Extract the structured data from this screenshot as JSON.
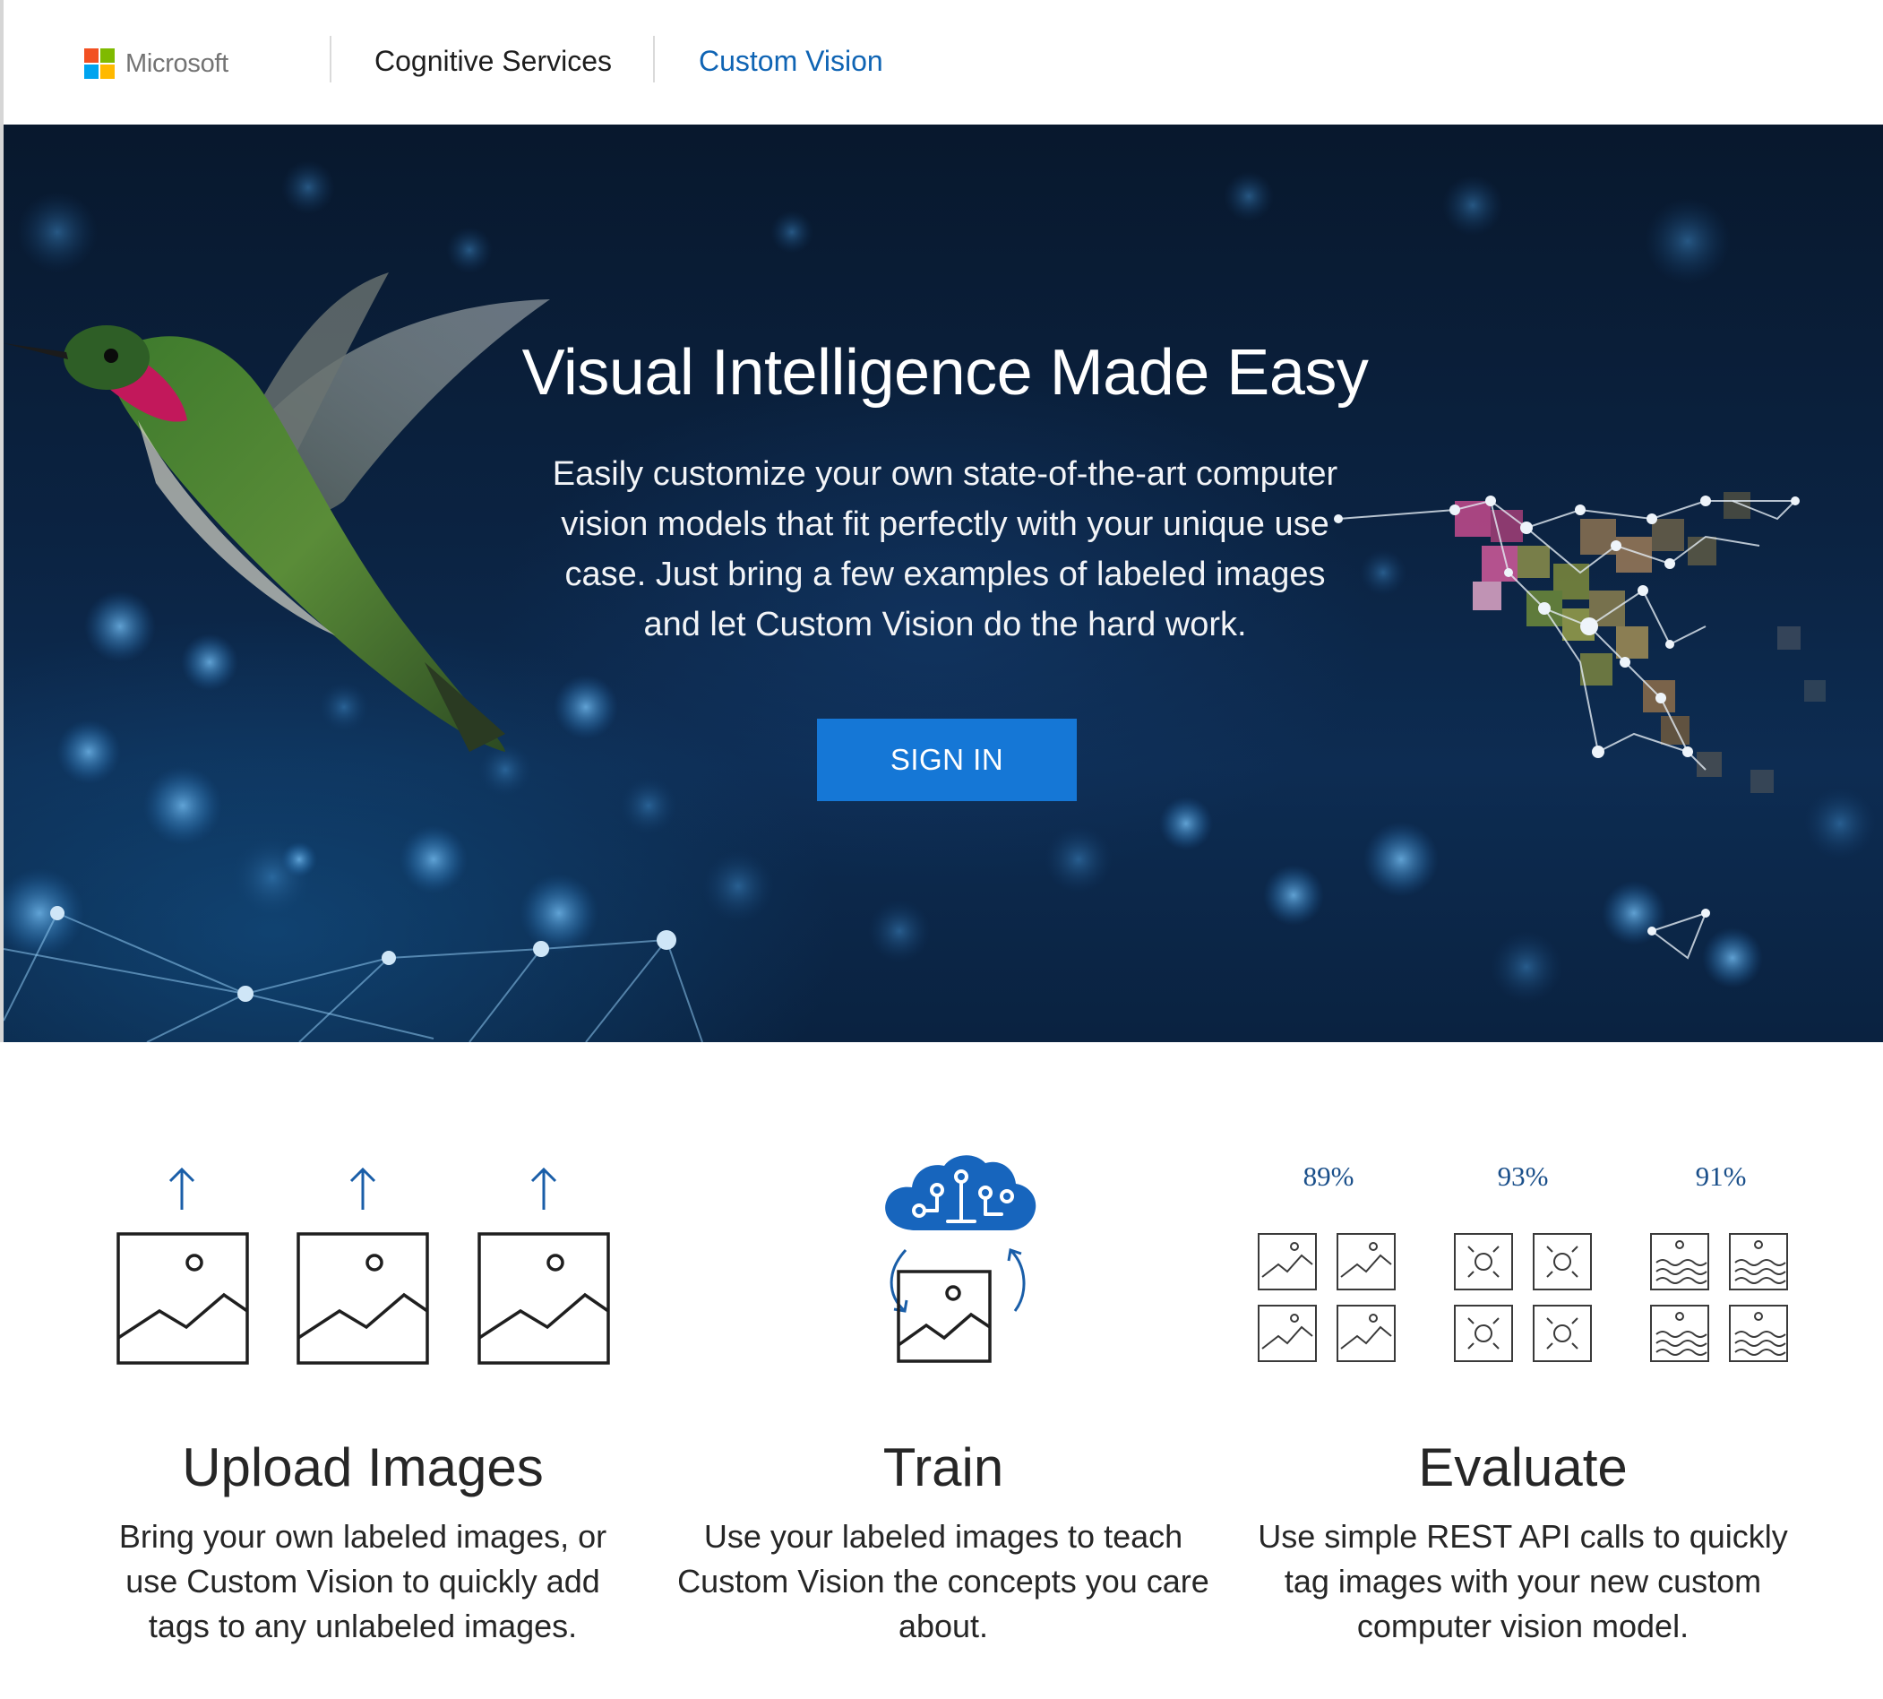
{
  "header": {
    "brand": "Microsoft",
    "logo_colors": [
      "#f25022",
      "#7fba00",
      "#00a4ef",
      "#ffb900"
    ],
    "nav": [
      {
        "label": "Cognitive Services"
      },
      {
        "label": "Custom Vision"
      }
    ],
    "active_color": "#0f64b4"
  },
  "hero": {
    "title": "Visual Intelligence Made Easy",
    "description": "Easily customize your own state-of-the-art computer vision models that fit perfectly with your unique use case. Just bring a few examples of labeled images and let Custom Vision do the hard work.",
    "cta_label": "SIGN IN",
    "cta_color": "#1577d6"
  },
  "features": [
    {
      "title": "Upload Images",
      "description": "Bring your own labeled images, or use Custom Vision to quickly add tags to any unlabeled images.",
      "icon": "upload-images-icon"
    },
    {
      "title": "Train",
      "description": "Use your labeled images to teach Custom Vision the concepts you care about.",
      "icon": "brain-cloud-icon"
    },
    {
      "title": "Evaluate",
      "description": "Use simple REST API calls to quickly tag images with your new custom computer vision model.",
      "icon": "evaluate-icon",
      "scores": [
        "89%",
        "93%",
        "91%"
      ]
    }
  ]
}
